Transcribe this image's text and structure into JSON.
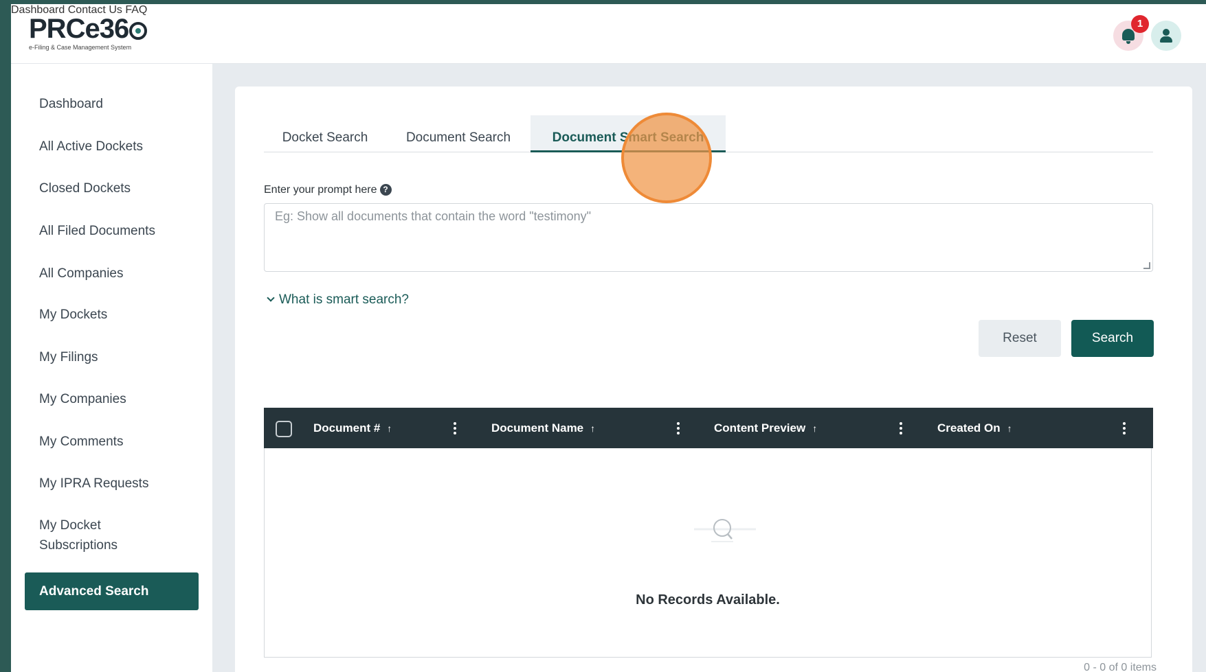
{
  "app": {
    "logo_text": "PRCe36",
    "logo_subtitle": "e-Filing & Case Management System"
  },
  "topnav": {
    "links": [
      "Dashboard",
      "Contact Us",
      "FAQ"
    ],
    "notification_count": "1",
    "notification_icon": "bell-icon",
    "user_icon": "user-icon"
  },
  "sidebar": {
    "items": [
      "Dashboard",
      "All Active Dockets",
      "Closed Dockets",
      "All Filed Documents",
      "All Companies",
      "My Dockets",
      "My Filings",
      "My Companies",
      "My Comments",
      "My IPRA Requests",
      "My Docket Subscriptions",
      "Advanced Search"
    ],
    "active": "Advanced Search"
  },
  "tabs": {
    "items": [
      "Docket Search",
      "Document Search",
      "Document Smart Search"
    ],
    "active": "Document Smart Search"
  },
  "prompt": {
    "label": "Enter your prompt here",
    "help_icon": "question-circle-icon",
    "placeholder": "Eg: Show all documents that contain the word \"testimony\"",
    "value": ""
  },
  "smart_search_toggle": "What is smart search?",
  "buttons": {
    "reset": "Reset",
    "search": "Search"
  },
  "grid": {
    "columns": [
      "Document #",
      "Document Name",
      "Content Preview",
      "Created On"
    ],
    "sort_icon": "↑",
    "rows": [],
    "empty_message": "No Records Available.",
    "pager_text": "0 - 0 of 0 items"
  },
  "colors": {
    "brand": "#1a5b57",
    "grid_header": "#26343a",
    "badge": "#e0262e",
    "click_indicator": "#ee8a37"
  }
}
